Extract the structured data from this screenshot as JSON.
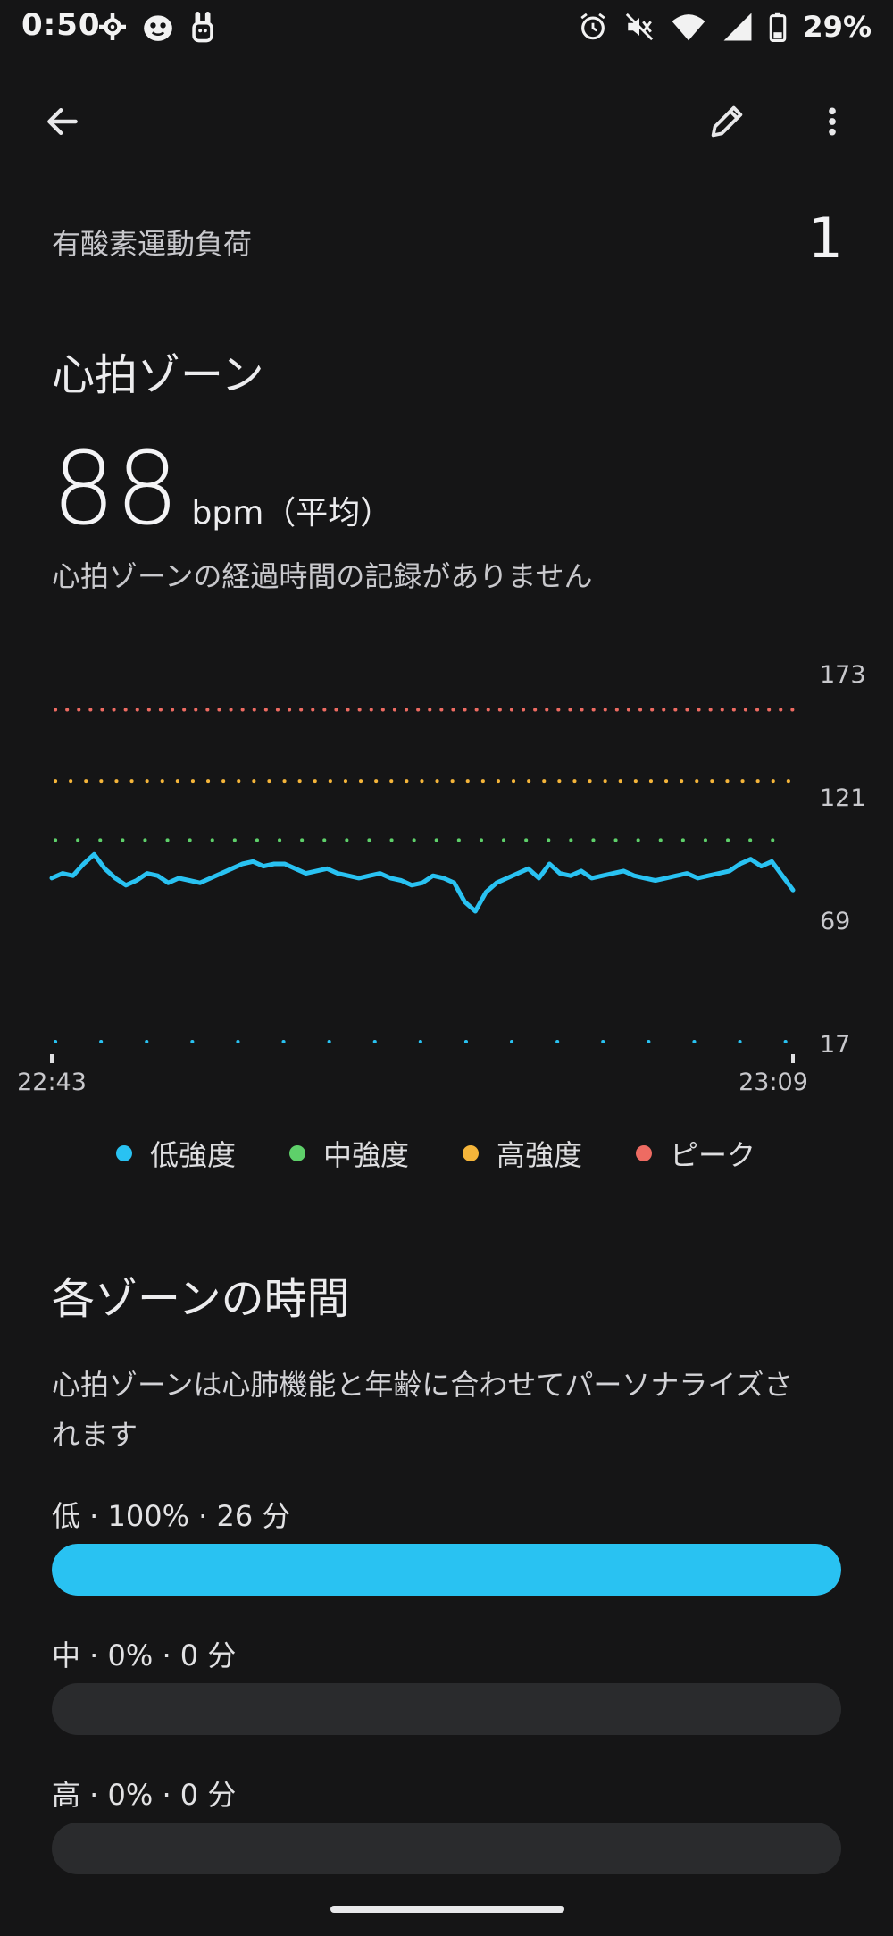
{
  "status_bar": {
    "time": "0:50",
    "battery": "29%"
  },
  "colors": {
    "low": "#29c2f2",
    "mid": "#5ed06a",
    "high": "#f5b53a",
    "peak": "#ee6b62",
    "track": "#2a2b2d"
  },
  "aerobic_load": {
    "label": "有酸素運動負荷",
    "value": "1"
  },
  "heart_zone": {
    "title": "心拍ゾーン",
    "avg_value": "88",
    "unit": "bpm（平均）",
    "note": "心拍ゾーンの経過時間の記録がありません"
  },
  "chart_data": {
    "type": "line",
    "y_ticks": [
      "173",
      "121",
      "69",
      "17"
    ],
    "ylim": [
      17,
      173
    ],
    "x_start": "22:43",
    "x_end": "23:09",
    "thresholds": [
      {
        "zone": "peak",
        "value": 157
      },
      {
        "zone": "high",
        "value": 127
      },
      {
        "zone": "mid",
        "value": 102
      },
      {
        "zone": "low",
        "value": 17
      }
    ],
    "series": [
      {
        "values": [
          86,
          88,
          87,
          92,
          96,
          90,
          86,
          83,
          85,
          88,
          87,
          84,
          86,
          85,
          84,
          86,
          88,
          90,
          92,
          93,
          91,
          92,
          92,
          90,
          88,
          89,
          90,
          88,
          87,
          86,
          87,
          88,
          86,
          85,
          83,
          84,
          87,
          86,
          84,
          76,
          72,
          80,
          84,
          86,
          88,
          90,
          86,
          92,
          88,
          87,
          89,
          86,
          87,
          88,
          89,
          87,
          86,
          85,
          86,
          87,
          88,
          86,
          87,
          88,
          89,
          92,
          94,
          91,
          93,
          87,
          81
        ]
      }
    ],
    "legend": [
      "低強度",
      "中強度",
      "高強度",
      "ピーク"
    ]
  },
  "zones_section": {
    "title": "各ゾーンの時間",
    "description_line1": "心拍ゾーンは心肺機能と年齢に合わせてパーソナライズさ",
    "description_line2": "れます",
    "zones": [
      {
        "label": "低 · 100% · 26 分",
        "fraction": 1.0
      },
      {
        "label": "中 · 0% · 0 分",
        "fraction": 0
      },
      {
        "label": "高 · 0% · 0 分",
        "fraction": 0
      }
    ]
  }
}
